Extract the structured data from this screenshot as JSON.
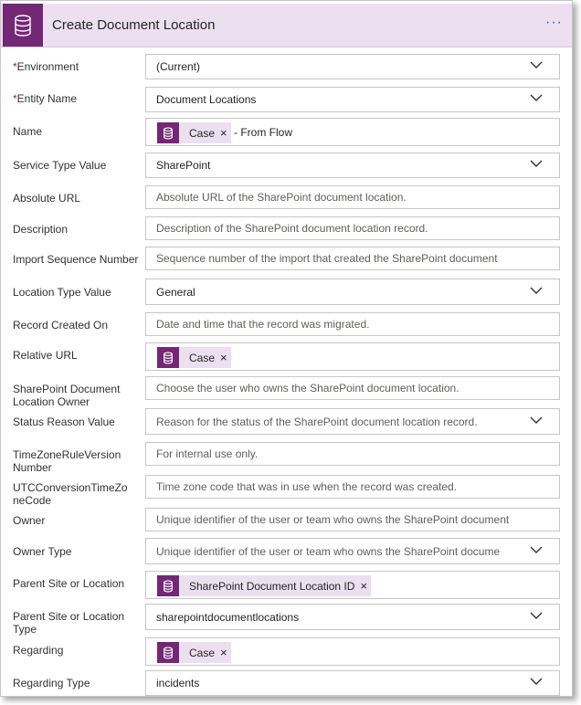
{
  "header": {
    "title": "Create Document Location",
    "more": "···"
  },
  "fields": [
    {
      "label": "Environment",
      "required": "*",
      "value": "(Current)"
    },
    {
      "label": "Entity Name",
      "required": "*",
      "value": "Document Locations"
    },
    {
      "label": "Name",
      "token": "Case",
      "suffix": "- From Flow"
    },
    {
      "label": "Service Type Value",
      "value": "SharePoint"
    },
    {
      "label": "Absolute URL",
      "placeholder": "Absolute URL of the SharePoint document location."
    },
    {
      "label": "Description",
      "placeholder": "Description of the SharePoint document location record."
    },
    {
      "label": "Import Sequence Number",
      "placeholder": "Sequence number of the import that created the SharePoint document"
    },
    {
      "label": "Location Type Value",
      "value": "General"
    },
    {
      "label": "Record Created On",
      "placeholder": "Date and time that the record was migrated."
    },
    {
      "label": "Relative URL",
      "token": "Case"
    },
    {
      "label": "SharePoint Document Location Owner",
      "placeholder": "Choose the user who owns the SharePoint document location."
    },
    {
      "label": "Status Reason Value",
      "placeholder": "Reason for the status of the SharePoint document location record."
    },
    {
      "label": "TimeZoneRuleVersion Number",
      "placeholder": "For internal use only."
    },
    {
      "label": "UTCConversionTimeZoneCode",
      "placeholder": "Time zone code that was in use when the record was created."
    },
    {
      "label": "Owner",
      "placeholder": "Unique identifier of the user or team who owns the SharePoint document"
    },
    {
      "label": "Owner Type",
      "placeholder": "Unique identifier of the user or team who owns the SharePoint docume"
    },
    {
      "label": "Parent Site or Location",
      "token": "SharePoint Document Location ID"
    },
    {
      "label": "Parent Site or Location Type",
      "value": "sharepointdocumentlocations"
    },
    {
      "label": "Regarding",
      "token": "Case"
    },
    {
      "label": "Regarding Type",
      "value": "incidents"
    }
  ],
  "icons": {
    "header": "database-icon",
    "token": "database-icon",
    "dropdown": "chevron-down-icon"
  },
  "colors": {
    "accent": "#742774",
    "header_bg": "#ece0f0",
    "link": "#0f6cbd"
  }
}
